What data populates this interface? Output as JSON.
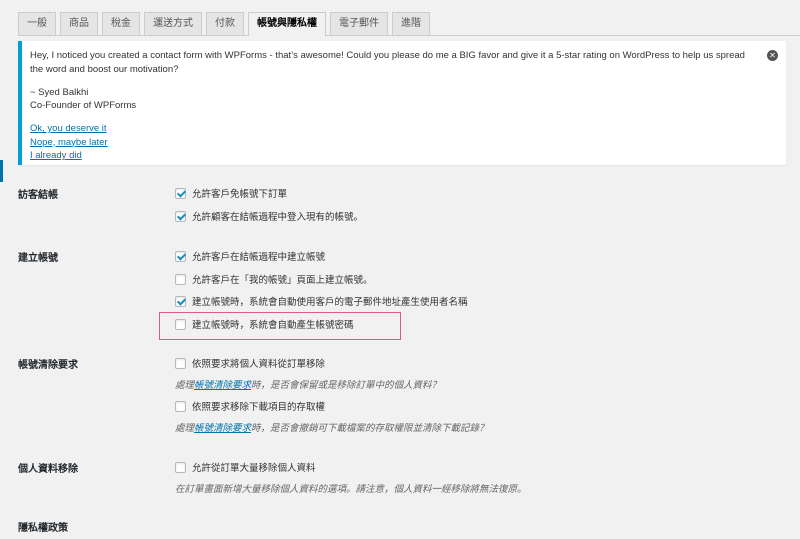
{
  "tabs": [
    "一般",
    "商品",
    "稅金",
    "運送方式",
    "付款",
    "帳號與隱私權",
    "電子郵件",
    "進階"
  ],
  "active_tab": "帳號與隱私權",
  "notice": {
    "message": "Hey, I noticed you created a contact form with WPForms - that’s awesome! Could you please do me a BIG favor and give it a 5-star rating on WordPress to help us spread the word and boost our motivation?",
    "signature_name": "~ Syed Balkhi",
    "signature_title": "Co-Founder of WPForms",
    "link_yes": "Ok, you deserve it",
    "link_later": "Nope, maybe later",
    "link_done": "I already did",
    "dismiss_icon": "⊗"
  },
  "sections": {
    "guest_checkout": {
      "label": "訪客結帳",
      "opt1": "允許客戶免帳號下訂單",
      "opt2": "允許顧客在結帳過程中登入現有的帳號。"
    },
    "account_creation": {
      "label": "建立帳號",
      "opt1": "允許客戶在結帳過程中建立帳號",
      "opt2": "允許客戶在「我的帳號」頁面上建立帳號。",
      "opt3": "建立帳號時，系統會自動使用客戶的電子郵件地址產生使用者名稱",
      "opt4": "建立帳號時，系統會自動產生帳號密碼"
    },
    "erasure": {
      "label": "帳號清除要求",
      "opt1": "依照要求將個人資料從訂單移除",
      "desc1_pre": "處理",
      "desc1_link": "帳號清除要求",
      "desc1_post": "時，是否會保留或是移除訂單中的個人資料？",
      "opt2": "依照要求移除下載項目的存取權",
      "desc2_pre": "處理",
      "desc2_link": "帳號清除要求",
      "desc2_post": "時，是否會撤銷可下載檔案的存取權限並清除下載記錄？"
    },
    "personal_data_removal": {
      "label": "個人資料移除",
      "opt1": "允許從訂單大量移除個人資料",
      "desc1": "在訂單畫面新增大量移除個人資料的選項。請注意，個人資料一經移除將無法復原。"
    },
    "privacy_policy": {
      "label": "隱私權政策"
    }
  },
  "colors": {
    "accent": "#0073aa",
    "notice_border": "#00a0d2",
    "highlight": "#e05a8a"
  }
}
